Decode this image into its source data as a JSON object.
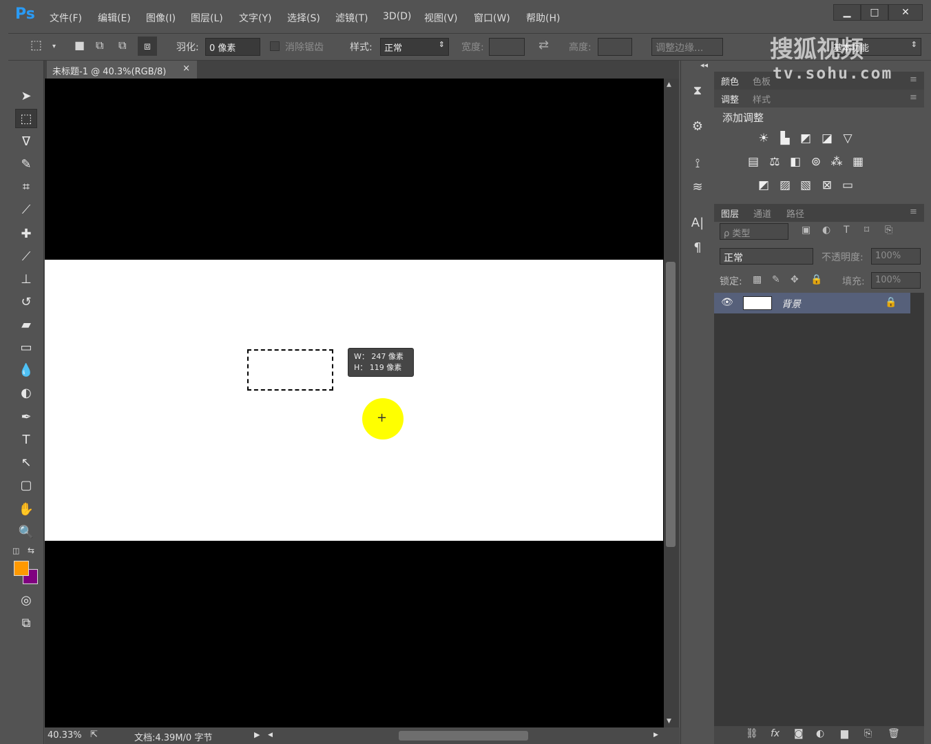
{
  "app": {
    "logo": "Ps"
  },
  "menu": [
    "文件(F)",
    "编辑(E)",
    "图像(I)",
    "图层(L)",
    "文字(Y)",
    "选择(S)",
    "滤镜(T)",
    "3D(D)",
    "视图(V)",
    "窗口(W)",
    "帮助(H)"
  ],
  "window_buttons": {
    "minimize": "▁",
    "maximize": "□",
    "close": "✕"
  },
  "options": {
    "feather_label": "羽化:",
    "feather_value": "0 像素",
    "antialias_label": "消除锯齿",
    "style_label": "样式:",
    "style_value": "正常",
    "width_label": "宽度:",
    "height_label": "高度:",
    "refine_edge": "调整边缘...",
    "workspace": "基本功能"
  },
  "document": {
    "tab_title": "未标题-1 @ 40.3%(RGB/8)",
    "tab_close": "×",
    "tooltip_w": "W： 247 像素",
    "tooltip_h": "H： 119 像素"
  },
  "status": {
    "zoom": "40.33%",
    "doc_info": "文档:4.39M/0 字节"
  },
  "colors": {
    "foreground": "#ff9900",
    "background": "#800080",
    "accent": "#2a9bf5",
    "cursor_highlight": "#ffff00"
  },
  "panels": {
    "color_tabs": [
      "颜色",
      "色板"
    ],
    "adjust_tabs": [
      "调整",
      "样式"
    ],
    "add_adjustment": "添加调整",
    "layers_tabs": [
      "图层",
      "通道",
      "路径"
    ],
    "filter_kind": "ρ 类型",
    "blend_mode": "正常",
    "opacity_label": "不透明度:",
    "opacity_value": "100%",
    "lock_label": "锁定:",
    "fill_label": "填充:",
    "fill_value": "100%",
    "layer_name": "背景"
  },
  "watermark": {
    "line1": "搜狐视频",
    "line2": "tv.sohu.com"
  }
}
